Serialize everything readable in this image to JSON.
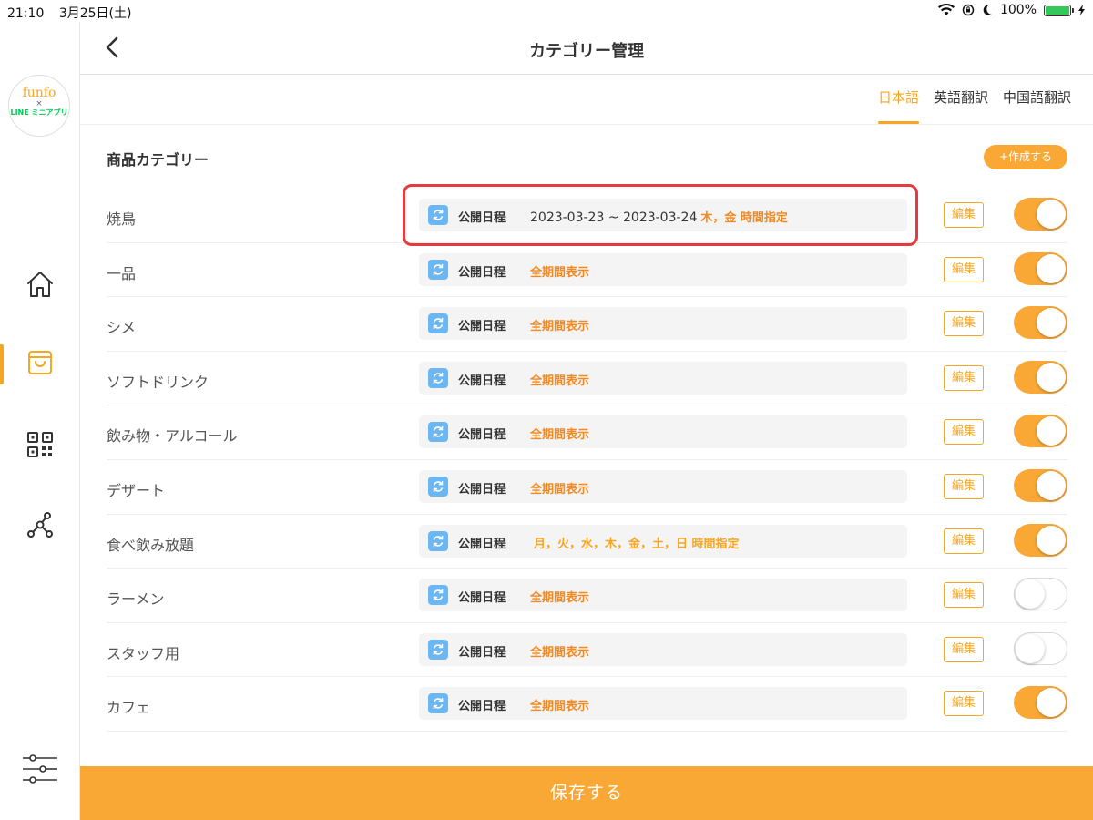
{
  "status_bar": {
    "time": "21:10",
    "date": "3月25日(土)",
    "battery": "100%"
  },
  "sidebar": {
    "logo": {
      "top": "funfo",
      "cross": "×",
      "bottom": "LINE ミニアプリ"
    },
    "items": [
      {
        "icon": "home-icon"
      },
      {
        "icon": "shopping-bag-icon",
        "active": true
      },
      {
        "icon": "qr-code-icon"
      },
      {
        "icon": "share-network-icon"
      },
      {
        "icon": "settings-sliders-icon"
      }
    ]
  },
  "header": {
    "title": "カテゴリー管理"
  },
  "tabs": [
    {
      "label": "日本語",
      "active": true
    },
    {
      "label": "英語翻訳",
      "active": false
    },
    {
      "label": "中国語翻訳",
      "active": false
    }
  ],
  "section": {
    "title": "商品カテゴリー",
    "create_label": "+作成する"
  },
  "schedule_label": "公開日程",
  "edit_label": "編集",
  "categories": [
    {
      "name": "焼鳥",
      "dates": "2023-03-23 ~ 2023-03-24",
      "schedule": "木，金 時間指定",
      "enabled": true
    },
    {
      "name": "一品",
      "dates": "",
      "schedule": "全期間表示",
      "enabled": true
    },
    {
      "name": "シメ",
      "dates": "",
      "schedule": "全期間表示",
      "enabled": true
    },
    {
      "name": "ソフトドリンク",
      "dates": "",
      "schedule": "全期間表示",
      "enabled": true
    },
    {
      "name": "飲み物・アルコール",
      "dates": "",
      "schedule": "全期間表示",
      "enabled": true
    },
    {
      "name": "デザート",
      "dates": "",
      "schedule": "全期間表示",
      "enabled": true
    },
    {
      "name": "食べ飲み放題",
      "dates": "",
      "schedule": "月，火，水，木，金，土，日 時間指定",
      "enabled": true
    },
    {
      "name": "ラーメン",
      "dates": "",
      "schedule": "全期間表示",
      "enabled": false
    },
    {
      "name": "スタッフ用",
      "dates": "",
      "schedule": "全期間表示",
      "enabled": false
    },
    {
      "name": "カフェ",
      "dates": "",
      "schedule": "全期間表示",
      "enabled": true
    }
  ],
  "footer": {
    "save_label": "保存する"
  },
  "colors": {
    "accent": "#f9a836",
    "schedule_icon": "#6bb7f4",
    "highlight": "#e63940"
  }
}
